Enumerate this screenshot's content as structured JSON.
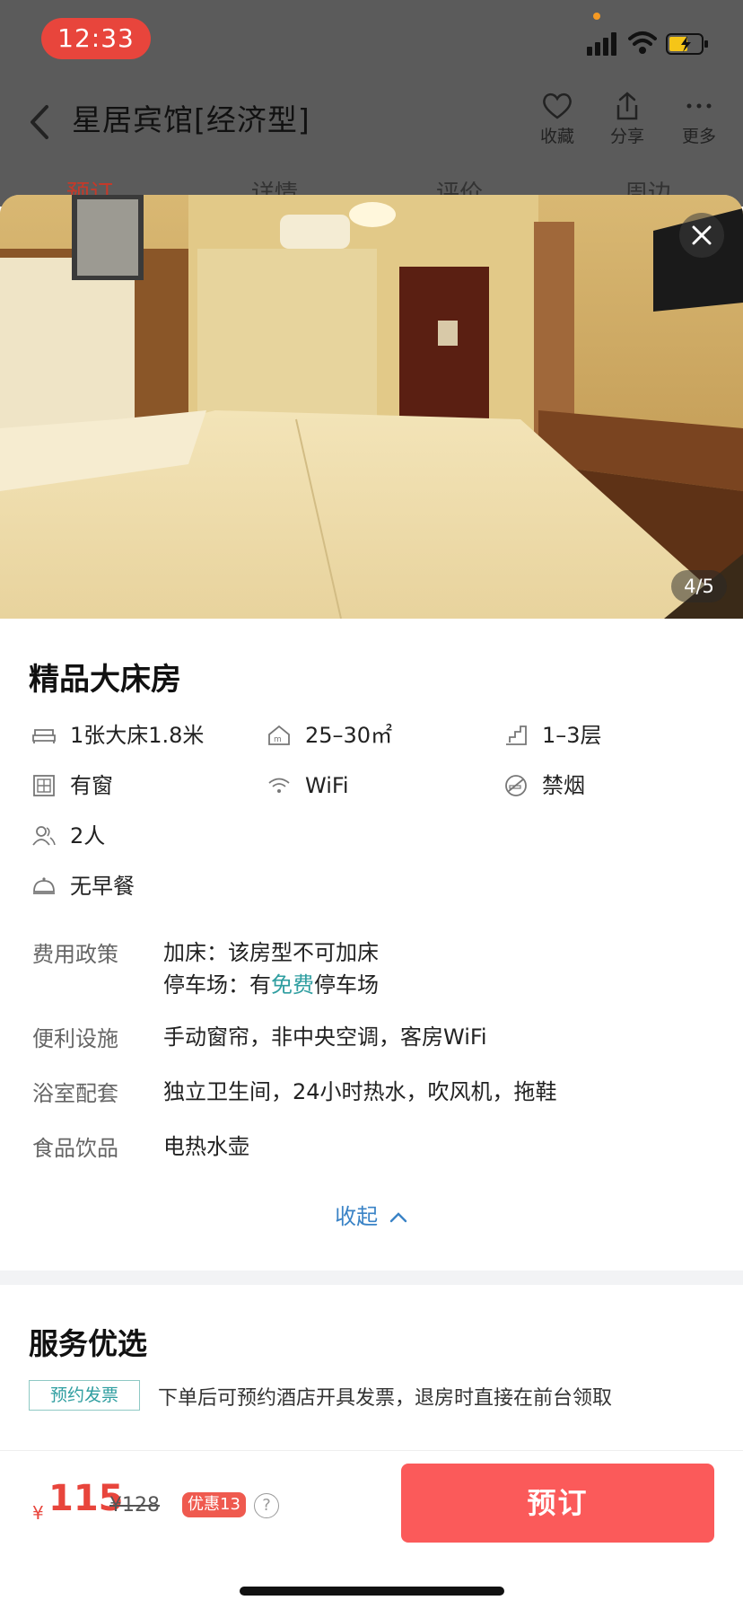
{
  "status_bar": {
    "time": "12:33"
  },
  "nav": {
    "title": "星居宾馆[经济型]",
    "actions": [
      {
        "label": "收藏",
        "icon": "heart-icon"
      },
      {
        "label": "分享",
        "icon": "share-icon"
      },
      {
        "label": "更多",
        "icon": "more-icon"
      }
    ]
  },
  "tabs": [
    "预订",
    "详情",
    "评价",
    "周边"
  ],
  "gallery": {
    "counter": "4/5"
  },
  "room": {
    "title": "精品大床房",
    "features": [
      {
        "icon": "bed-icon",
        "label": "1张大床1.8米"
      },
      {
        "icon": "area-icon",
        "label": "25–30㎡"
      },
      {
        "icon": "floor-icon",
        "label": "1–3层"
      },
      {
        "icon": "window-icon",
        "label": "有窗"
      },
      {
        "icon": "wifi-icon",
        "label": "WiFi"
      },
      {
        "icon": "no-smoking-icon",
        "label": "禁烟"
      },
      {
        "icon": "guests-icon",
        "label": "2人"
      },
      {
        "icon": "breakfast-icon",
        "label": "无早餐"
      }
    ],
    "policies": {
      "fee_label": "费用政策",
      "extra_bed": "加床：该房型不可加床",
      "parking_prefix": "停车场：有",
      "parking_free": "免费",
      "parking_suffix": "停车场",
      "amenities_label": "便利设施",
      "amenities": "手动窗帘，非中央空调，客房WiFi",
      "bath_label": "浴室配套",
      "bath": "独立卫生间，24小时热水，吹风机，拖鞋",
      "food_label": "食品饮品",
      "food": "电热水壶"
    },
    "collapse_label": "收起"
  },
  "services": {
    "title": "服务优选",
    "tag": "预约发票",
    "desc": "下单后可预约酒店开具发票，退房时直接在前台领取"
  },
  "booking": {
    "currency": "¥",
    "price": "115",
    "original": "¥128",
    "discount": "优惠13",
    "help": "?",
    "book_label": "预订"
  },
  "colors": {
    "accent_red": "#fb5a5a",
    "price_red": "#e8453c",
    "link_blue": "#3a83c6",
    "teal": "#2f9ea0"
  }
}
